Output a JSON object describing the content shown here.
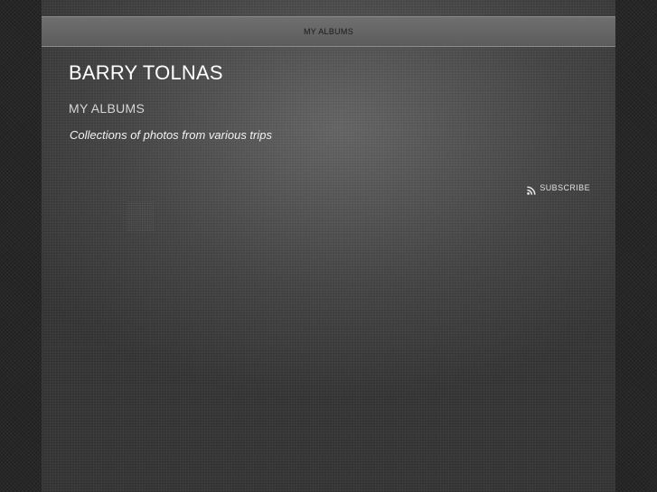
{
  "nav": {
    "items": [
      {
        "label": "MY ALBUMS"
      }
    ]
  },
  "site": {
    "title": "BARRY TOLNAS"
  },
  "section": {
    "title": "MY ALBUMS",
    "description": "Collections of photos from various trips"
  },
  "subscribe": {
    "label": "SUBSCRIBE",
    "icon": "rss-icon"
  },
  "colors": {
    "background": "#262626",
    "panel": "#3a3a3a",
    "navbar": "#666666",
    "text": "#ffffff"
  }
}
